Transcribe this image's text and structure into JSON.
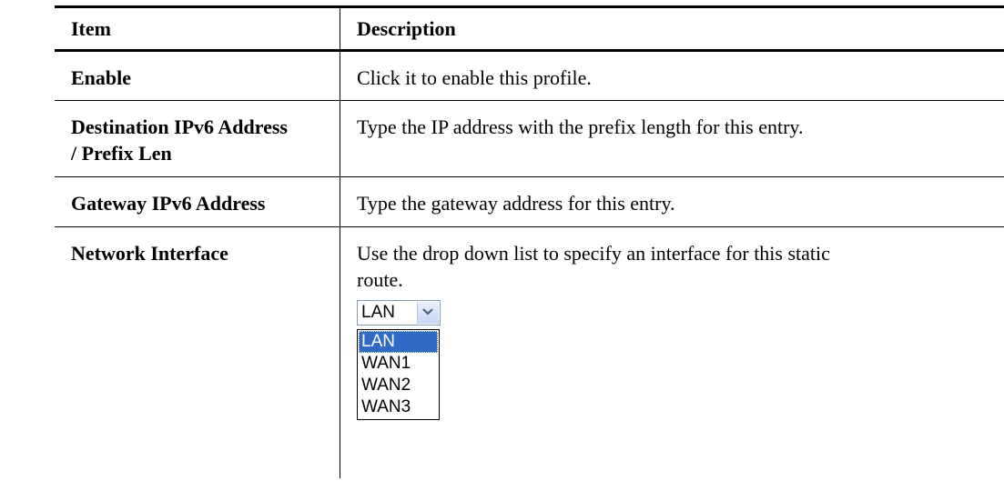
{
  "table": {
    "header": {
      "item": "Item",
      "description": "Description"
    },
    "rows": [
      {
        "item": "Enable",
        "description": "Click it to enable this profile."
      },
      {
        "item_line1": "Destination IPv6 Address",
        "item_line2": "/ Prefix Len",
        "description": "Type the IP address with the prefix length for this entry."
      },
      {
        "item": "Gateway IPv6 Address",
        "description": "Type the gateway address for this entry."
      },
      {
        "item": "Network Interface",
        "description_line1": "Use the drop down list to specify an interface for this static",
        "description_line2": "route."
      }
    ]
  },
  "dropdown": {
    "selected": "LAN",
    "options": [
      "LAN",
      "WAN1",
      "WAN2",
      "WAN3"
    ],
    "highlighted": "LAN",
    "arrow_icon": "chevron-down-icon"
  },
  "colors": {
    "highlight": "#316ac5",
    "border": "#7f9db9"
  }
}
